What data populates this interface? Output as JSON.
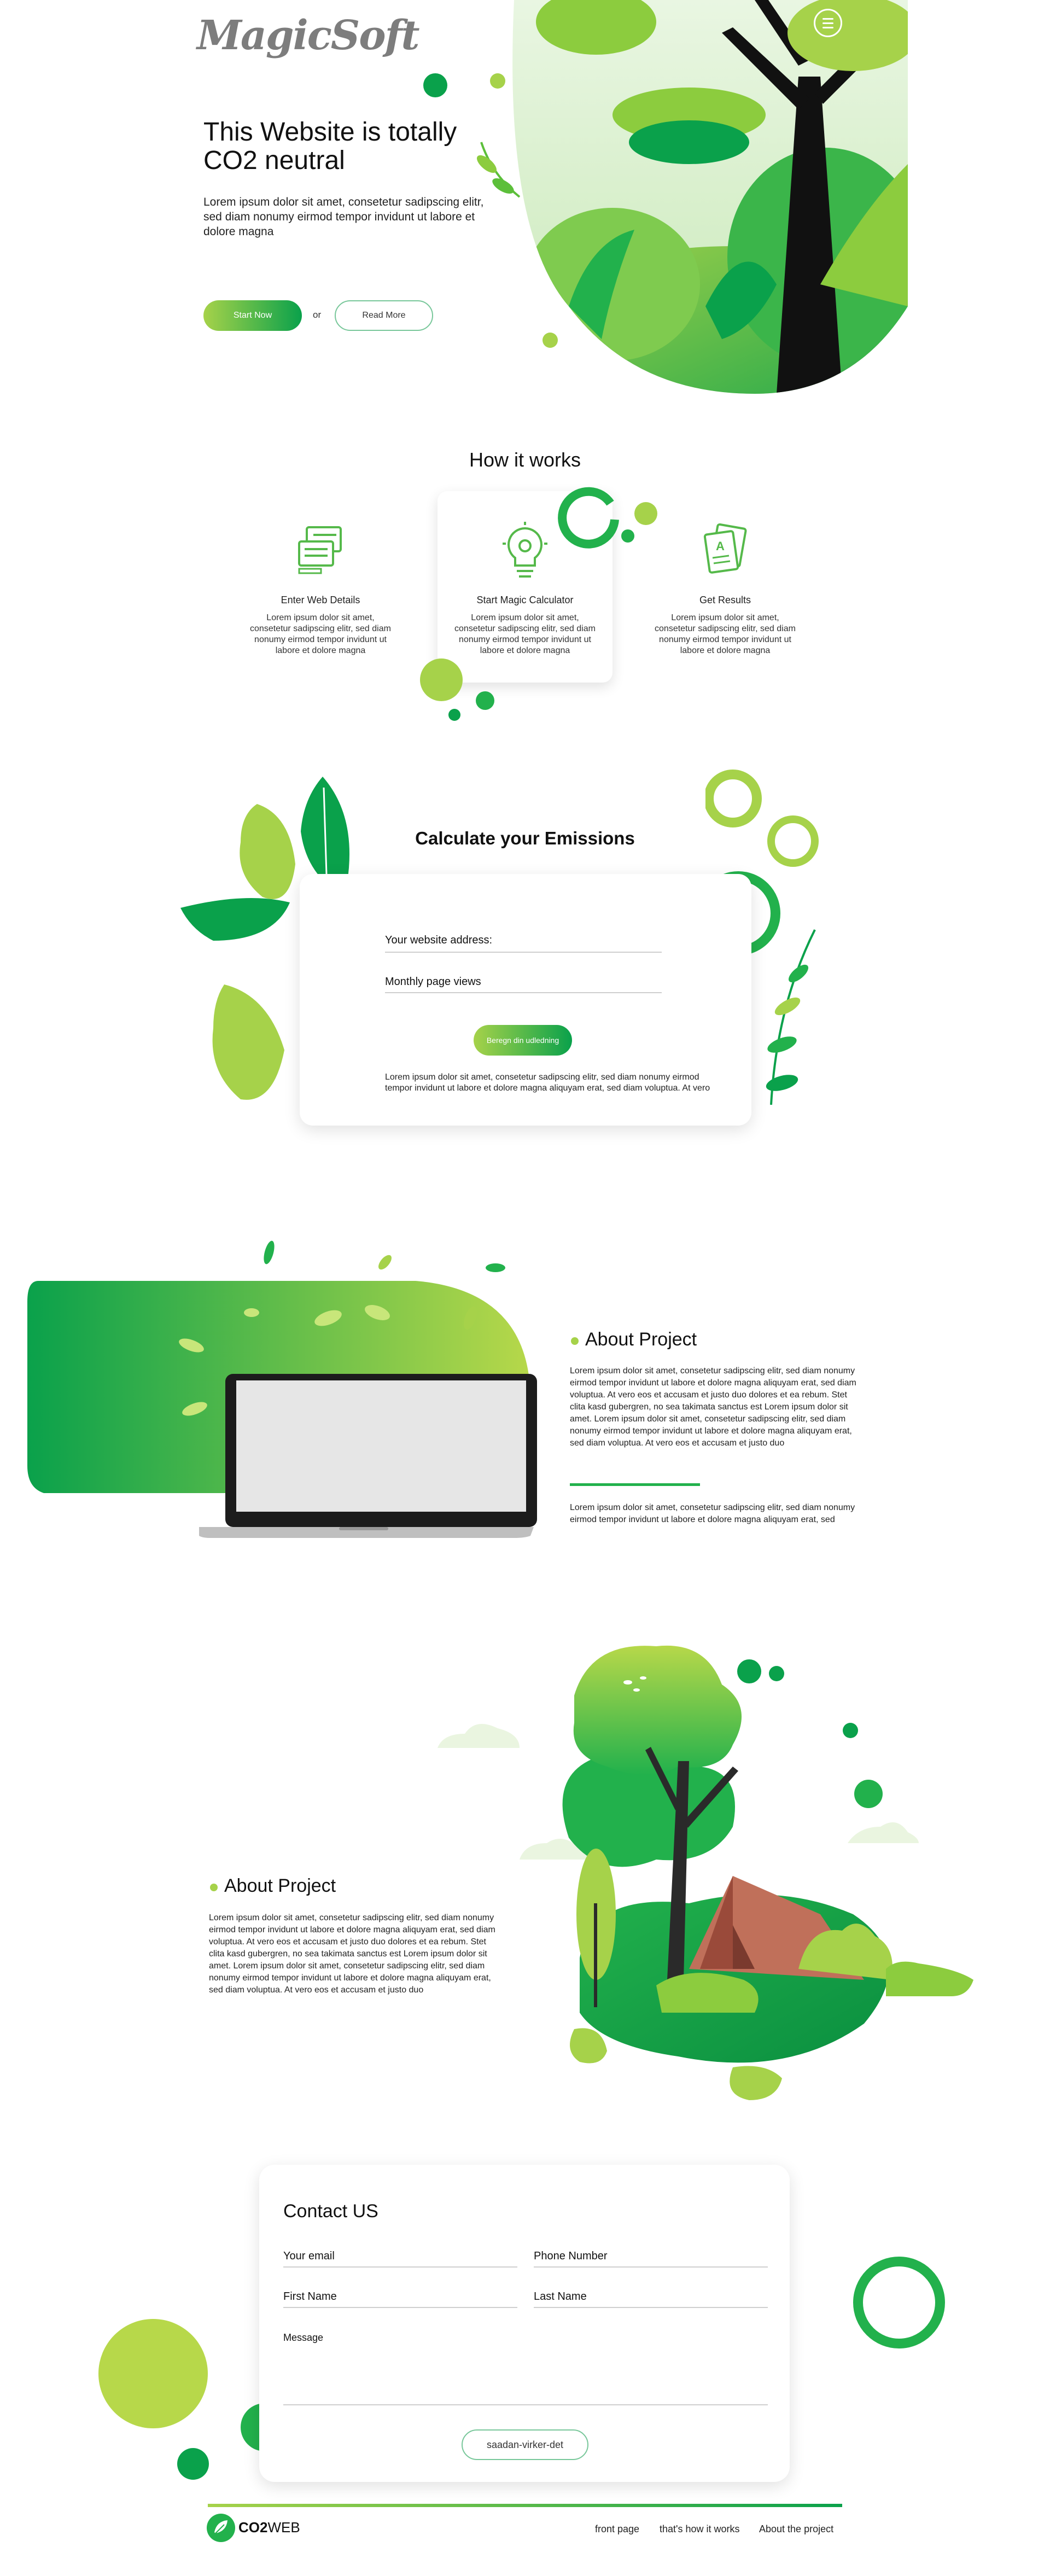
{
  "brand": {
    "logo_text": "MagicSoft",
    "menu_icon": "hamburger-icon"
  },
  "hero": {
    "title": "This Website is totally CO2 neutral",
    "text": "Lorem ipsum dolor sit amet, consetetur sadipscing elitr, sed diam nonumy eirmod tempor invidunt ut labore et dolore magna",
    "start_label": "Start Now",
    "or_label": "or",
    "read_label": "Read More"
  },
  "how": {
    "title": "How it works",
    "steps": [
      {
        "label": "Enter Web Details",
        "desc": "Lorem ipsum dolor sit amet, consetetur sadipscing elitr, sed diam nonumy eirmod tempor invidunt ut labore et dolore magna",
        "icon": "web-form-icon"
      },
      {
        "label": "Start Magic Calculator",
        "desc": "Lorem ipsum dolor sit amet, consetetur sadipscing elitr, sed diam nonumy eirmod tempor invidunt ut labore et dolore magna",
        "icon": "lightbulb-gear-icon"
      },
      {
        "label": "Get Results",
        "desc": "Lorem ipsum dolor sit amet, consetetur sadipscing elitr, sed diam nonumy eirmod tempor invidunt ut labore et dolore magna",
        "icon": "grade-document-icon"
      }
    ]
  },
  "calc": {
    "title": "Calculate your Emissions",
    "website_label": "Your website address:",
    "views_label": "Monthly page views",
    "button_label": "Beregn din udledning",
    "footnote": "Lorem ipsum dolor sit amet, consetetur sadipscing elitr, sed diam nonumy eirmod tempor invidunt ut labore et dolore magna aliquyam erat, sed diam voluptua. At vero"
  },
  "about1": {
    "title": "About Project",
    "text": "Lorem ipsum dolor sit amet, consetetur sadipscing elitr, sed diam nonumy eirmod tempor invidunt ut labore et dolore magna aliquyam erat, sed diam voluptua. At vero eos et accusam et justo duo dolores et ea rebum. Stet clita kasd gubergren, no sea takimata sanctus est Lorem ipsum dolor sit amet. Lorem ipsum dolor sit amet, consetetur sadipscing elitr, sed diam nonumy eirmod tempor invidunt ut labore et dolore magna aliquyam erat, sed diam voluptua. At vero eos et accusam et justo duo",
    "text2": "Lorem ipsum dolor sit amet, consetetur sadipscing elitr, sed diam nonumy eirmod tempor invidunt ut labore et dolore magna aliquyam erat, sed"
  },
  "about2": {
    "title": "About Project",
    "text": "Lorem ipsum dolor sit amet, consetetur sadipscing elitr, sed diam nonumy eirmod tempor invidunt ut labore et dolore magna aliquyam erat, sed diam voluptua. At vero eos et accusam et justo duo dolores et ea rebum. Stet clita kasd gubergren, no sea takimata sanctus est Lorem ipsum dolor sit amet. Lorem ipsum dolor sit amet, consetetur sadipscing elitr, sed diam nonumy eirmod tempor invidunt ut labore et dolore magna aliquyam erat, sed diam voluptua. At vero eos et accusam et justo duo"
  },
  "contact": {
    "title": "Contact US",
    "email_label": "Your email",
    "phone_label": "Phone Number",
    "first_label": "First Name",
    "last_label": "Last Name",
    "message_label": "Message",
    "send_label": "saadan-virker-det"
  },
  "footer": {
    "brand_co2": "CO2",
    "brand_web": "WEB",
    "links": [
      "front page",
      "that's how it works",
      "About the project"
    ]
  },
  "colors": {
    "green_dark": "#0aa14b",
    "green_light": "#a6d24a",
    "green_mid": "#22b14c"
  }
}
